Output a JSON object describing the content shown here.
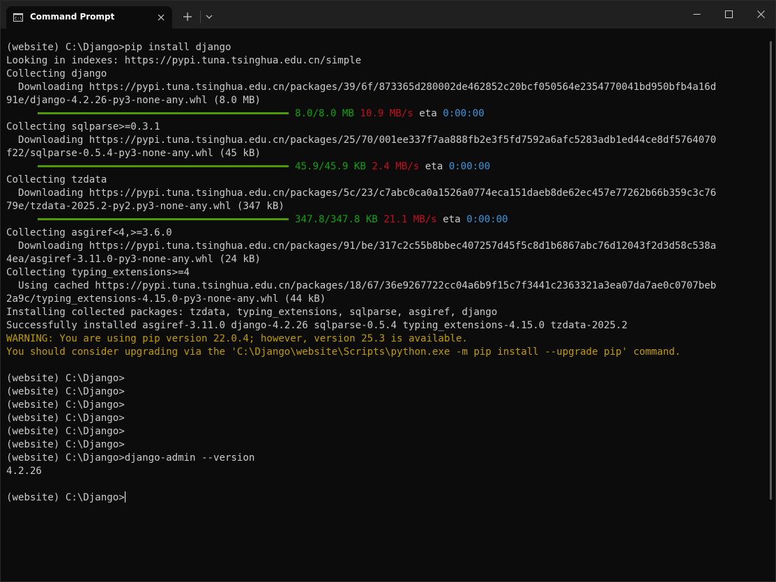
{
  "window": {
    "tab_title": "Command Prompt",
    "icons": {
      "tab": "cmd-icon",
      "close_tab": "close-icon",
      "new_tab": "plus-icon",
      "dropdown": "chevron-down-icon",
      "minimize": "minimize-icon",
      "maximize": "maximize-icon",
      "close": "close-icon"
    }
  },
  "colors": {
    "background": "#0c0c0c",
    "text": "#cccccc",
    "green": "#13a10e",
    "red": "#c50f1f",
    "blue": "#3a96dd",
    "warning": "#c19c00",
    "progress_bar": "#4e9a06"
  },
  "console": {
    "prompt": "(website) C:\\Django>",
    "lines": {
      "l01": "(website) C:\\Django>pip install django",
      "l02": "Looking in indexes: https://pypi.tuna.tsinghua.edu.cn/simple",
      "l03": "Collecting django",
      "l04": "  Downloading https://pypi.tuna.tsinghua.edu.cn/packages/39/6f/873365d280002de462852c20bcf050564e2354770041bd950bfb4a16d",
      "l05": "91e/django-4.2.26-py3-none-any.whl (8.0 MB)",
      "l07": "Collecting sqlparse>=0.3.1",
      "l08": "  Downloading https://pypi.tuna.tsinghua.edu.cn/packages/25/70/001ee337f7aa888fb2e3f5fd7592a6afc5283adb1ed44ce8df5764070",
      "l09": "f22/sqlparse-0.5.4-py3-none-any.whl (45 kB)",
      "l11": "Collecting tzdata",
      "l12": "  Downloading https://pypi.tuna.tsinghua.edu.cn/packages/5c/23/c7abc0ca0a1526a0774eca151daeb8de62ec457e77262b66b359c3c76",
      "l13": "79e/tzdata-2025.2-py2.py3-none-any.whl (347 kB)",
      "l15": "Collecting asgiref<4,>=3.6.0",
      "l16": "  Downloading https://pypi.tuna.tsinghua.edu.cn/packages/91/be/317c2c55b8bbec407257d45f5c8d1b6867abc76d12043f2d3d58c538a",
      "l17": "4ea/asgiref-3.11.0-py3-none-any.whl (24 kB)",
      "l18": "Collecting typing_extensions>=4",
      "l19": "  Using cached https://pypi.tuna.tsinghua.edu.cn/packages/18/67/36e9267722cc04a6b9f15c7f3441c2363321a3ea07da7ae0c0707beb",
      "l20": "2a9c/typing_extensions-4.15.0-py3-none-any.whl (44 kB)",
      "l21": "Installing collected packages: tzdata, typing_extensions, sqlparse, asgiref, django",
      "l22": "Successfully installed asgiref-3.11.0 django-4.2.26 sqlparse-0.5.4 typing_extensions-4.15.0 tzdata-2025.2",
      "l23": "WARNING: You are using pip version 22.0.4; however, version 25.3 is available.",
      "l24": "You should consider upgrading via the 'C:\\Django\\website\\Scripts\\python.exe -m pip install --upgrade pip' command.",
      "l26": "(website) C:\\Django>",
      "l27": "(website) C:\\Django>",
      "l28": "(website) C:\\Django>",
      "l29": "(website) C:\\Django>",
      "l30": "(website) C:\\Django>",
      "l31": "(website) C:\\Django>",
      "l32": "(website) C:\\Django>django-admin --version",
      "l33": "4.2.26"
    },
    "progress": [
      {
        "fraction": 1.0,
        "size": "8.0/8.0 MB",
        "speed": "10.9 MB/s",
        "eta_label": "eta",
        "eta": "0:00:00"
      },
      {
        "fraction": 1.0,
        "size": "45.9/45.9 KB",
        "speed": "2.4 MB/s",
        "eta_label": "eta",
        "eta": "0:00:00"
      },
      {
        "fraction": 1.0,
        "size": "347.8/347.8 KB",
        "speed": "21.1 MB/s",
        "eta_label": "eta",
        "eta": "0:00:00"
      }
    ]
  }
}
